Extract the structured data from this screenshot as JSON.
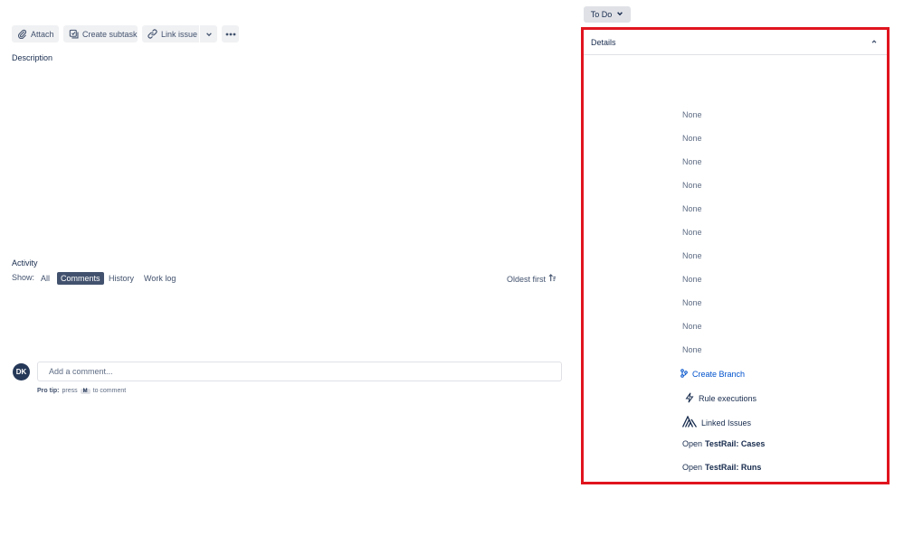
{
  "toolbar": {
    "attach_label": "Attach",
    "create_subtask_label": "Create subtask",
    "link_issue_label": "Link issue",
    "icons": [
      "paperclip-icon",
      "subtask-icon",
      "link-icon",
      "chevron-down-icon",
      "more-icon"
    ]
  },
  "description": {
    "label": "Description"
  },
  "activity": {
    "label": "Activity",
    "show_label": "Show:",
    "filters": [
      "All",
      "Comments",
      "History",
      "Work log"
    ],
    "active_filter": "Comments",
    "sort_label": "Oldest first"
  },
  "comment": {
    "avatar_initials": "DK",
    "placeholder": "Add a comment...",
    "protip_bold": "Pro tip:",
    "protip_text": "press",
    "protip_key": "M",
    "protip_suffix": "to comment"
  },
  "status": {
    "label": "To Do"
  },
  "details": {
    "title": "Details",
    "none_values": [
      "None",
      "None",
      "None",
      "None",
      "None",
      "None",
      "None",
      "None",
      "None",
      "None",
      "None"
    ],
    "create_branch_label": "Create Branch",
    "rule_executions_label": "Rule executions",
    "linked_issues_label": "Linked Issues",
    "testrail_cases": {
      "prefix": "Open",
      "name": "TestRail: Cases"
    },
    "testrail_runs": {
      "prefix": "Open",
      "name": "TestRail: Runs"
    }
  },
  "colors": {
    "highlight_border": "#e0141e",
    "active_filter_bg": "#42526e",
    "link": "#0052cc",
    "avatar_bg": "#253858"
  }
}
